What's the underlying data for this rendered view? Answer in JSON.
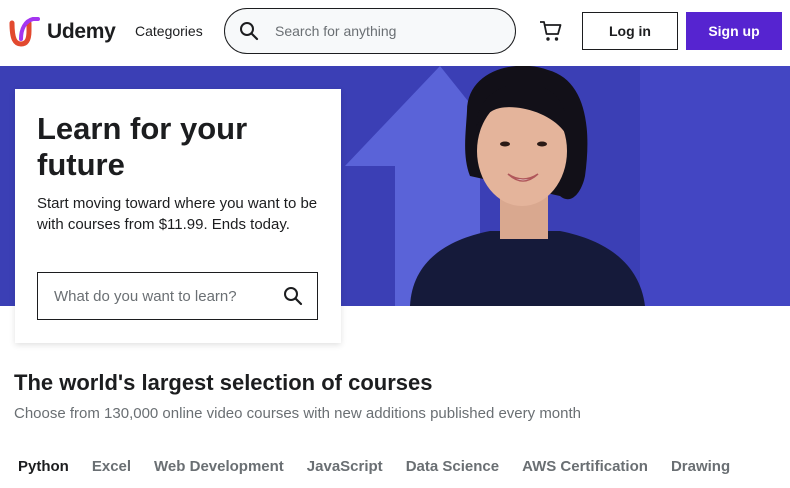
{
  "header": {
    "brand": "Udemy",
    "categories_label": "Categories",
    "search_placeholder": "Search for anything",
    "login_label": "Log in",
    "signup_label": "Sign up",
    "icons": {
      "search": "search-icon",
      "cart": "cart-icon",
      "logo": "udemy-logo-icon"
    }
  },
  "hero": {
    "title": "Learn for your future",
    "subtitle": "Start moving toward where you want to be with courses from $11.99. Ends today.",
    "search_placeholder": "What do you want to learn?",
    "icons": {
      "search": "search-icon"
    }
  },
  "courses_section": {
    "title": "The world's largest selection of courses",
    "subtitle": "Choose from 130,000 online video courses with new additions published every month",
    "tabs": [
      {
        "label": "Python",
        "active": true
      },
      {
        "label": "Excel",
        "active": false
      },
      {
        "label": "Web Development",
        "active": false
      },
      {
        "label": "JavaScript",
        "active": false
      },
      {
        "label": "Data Science",
        "active": false
      },
      {
        "label": "AWS Certification",
        "active": false
      },
      {
        "label": "Drawing",
        "active": false
      }
    ]
  },
  "colors": {
    "brand_purple": "#5624d0",
    "hero_background": "#3b3fb5",
    "logo_accent": "#a435f0",
    "text_primary": "#1c1d1f",
    "text_secondary": "#6a6f73"
  }
}
